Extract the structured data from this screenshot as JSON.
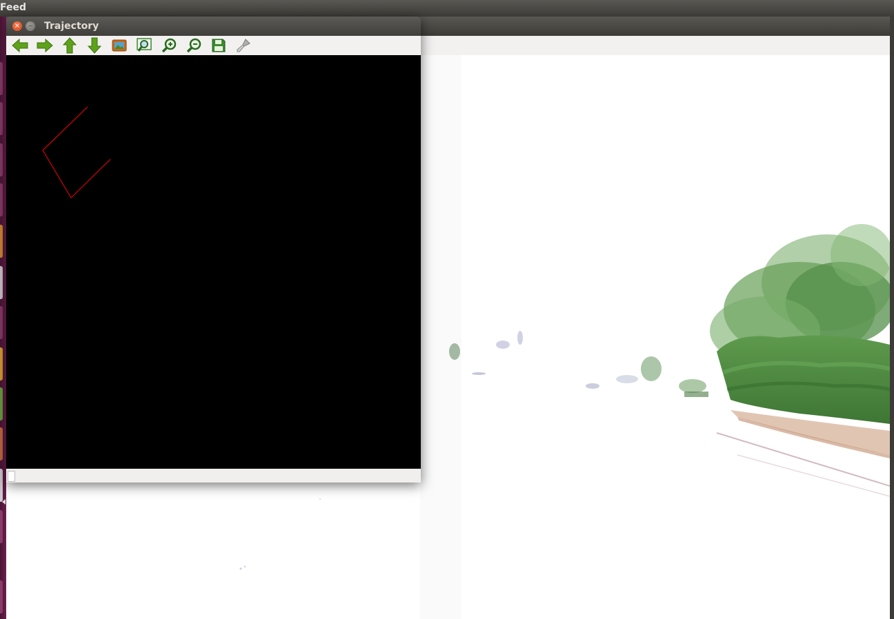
{
  "top_bar": {
    "title": "Feed"
  },
  "trajectory_window": {
    "title": "Trajectory",
    "close_glyph": "×",
    "minimize_glyph": "–",
    "toolbar": [
      {
        "name": "pan-left-icon",
        "color": "#5ea11b"
      },
      {
        "name": "pan-right-icon",
        "color": "#5ea11b"
      },
      {
        "name": "pan-up-icon",
        "color": "#5ea11b"
      },
      {
        "name": "pan-down-icon",
        "color": "#5ea11b"
      },
      {
        "name": "zoom-original-icon",
        "color": "#c46a1d"
      },
      {
        "name": "zoom-fit-icon",
        "color": "#3a8a2a"
      },
      {
        "name": "zoom-in-icon",
        "color": "#3a8a2a"
      },
      {
        "name": "zoom-out-icon",
        "color": "#3a8a2a"
      },
      {
        "name": "save-icon",
        "color": "#3a8a2a"
      },
      {
        "name": "properties-icon",
        "color": "#888888"
      }
    ],
    "trajectory_color": "#ff0000",
    "canvas_background": "#000000"
  },
  "feed_window": {
    "scene": "street-camera-feed-overexposed"
  }
}
